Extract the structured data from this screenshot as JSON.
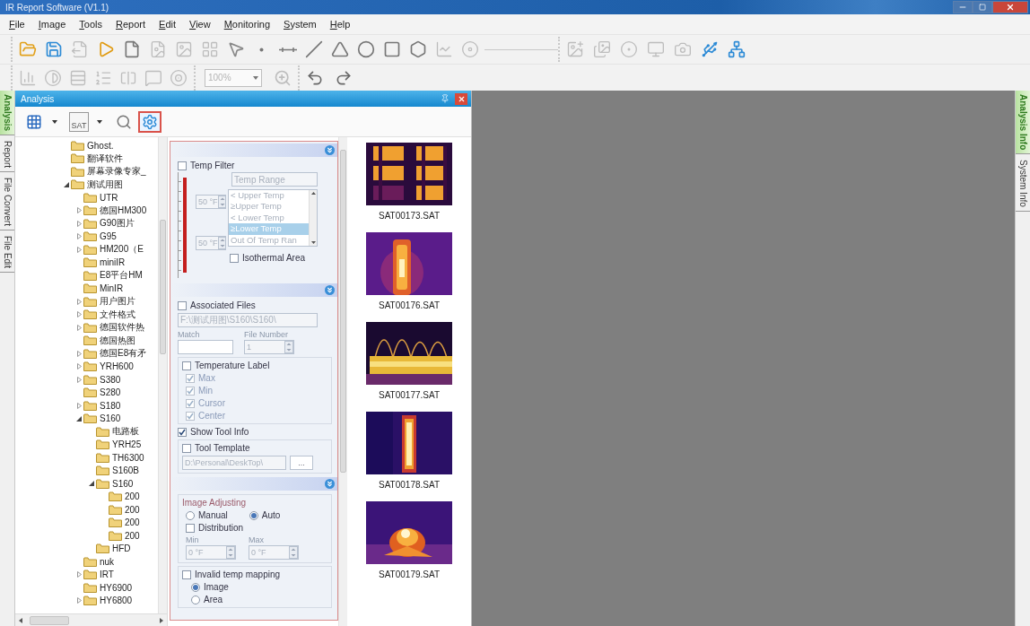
{
  "window": {
    "title": "IR Report Software (V1.1)"
  },
  "menu": [
    {
      "label": "File"
    },
    {
      "label": "Image"
    },
    {
      "label": "Tools"
    },
    {
      "label": "Report"
    },
    {
      "label": "Edit"
    },
    {
      "label": "View"
    },
    {
      "label": "Monitoring"
    },
    {
      "label": "System"
    },
    {
      "label": "Help"
    }
  ],
  "toolbars": {
    "main": [
      {
        "disabled": false
      },
      {
        "disabled": false
      },
      {
        "disabled": true
      },
      {
        "disabled": false
      },
      {
        "disabled": false
      },
      {
        "disabled": true
      },
      {
        "disabled": true
      },
      {
        "disabled": true
      },
      {
        "disabled": false
      },
      {
        "disabled": false
      },
      {
        "disabled": false
      },
      {
        "disabled": false
      },
      {
        "disabled": false
      },
      {
        "disabled": false
      },
      {
        "disabled": false
      },
      {
        "disabled": false
      },
      {
        "disabled": true
      },
      {
        "disabled": true
      }
    ],
    "devices": [
      {
        "disabled": true
      },
      {
        "disabled": true
      },
      {
        "disabled": true
      },
      {
        "disabled": true
      },
      {
        "disabled": true
      },
      {
        "disabled": false
      },
      {
        "disabled": false
      }
    ],
    "view": [
      {
        "disabled": true
      },
      {
        "disabled": true
      },
      {
        "disabled": true
      },
      {
        "disabled": true
      },
      {
        "disabled": true
      },
      {
        "disabled": true
      },
      {
        "disabled": true
      }
    ],
    "zoom": {
      "value": "100%",
      "disabled": true
    },
    "history": [
      {
        "disabled": false
      },
      {
        "disabled": false
      }
    ]
  },
  "left_tabs": [
    {
      "label": "Analysis",
      "selected": true
    },
    {
      "label": "Report",
      "selected": false
    },
    {
      "label": "File Convert",
      "selected": false
    },
    {
      "label": "File Edit",
      "selected": false
    }
  ],
  "right_tabs": [
    {
      "label": "Analysis Info",
      "selected": true
    },
    {
      "label": "System Info",
      "selected": false
    }
  ],
  "panel": {
    "title": "Analysis"
  },
  "analysis_tools": [
    {
      "selected": false,
      "menu": true
    },
    {
      "selected": false,
      "menu": true,
      "badge": "SAT"
    },
    {
      "selected": false
    },
    {
      "selected": true
    }
  ],
  "tree": {
    "items": [
      {
        "label": "Ghost."
      },
      {
        "label": "翻译软件"
      },
      {
        "label": "屏幕录像专家_"
      },
      {
        "label": "测试用图",
        "expanded": true,
        "children": [
          {
            "label": "UTR"
          },
          {
            "label": "德国HM300",
            "expanded": false
          },
          {
            "label": "G90图片",
            "expanded": false
          },
          {
            "label": "G95",
            "expanded": false
          },
          {
            "label": "HM200（E",
            "expanded": false
          },
          {
            "label": "miniIR"
          },
          {
            "label": "E8平台HM"
          },
          {
            "label": "MinIR"
          },
          {
            "label": "用户图片",
            "expanded": false
          },
          {
            "label": "文件格式",
            "expanded": false
          },
          {
            "label": "德国软件热",
            "expanded": false
          },
          {
            "label": "德国热图"
          },
          {
            "label": "德国E8有矛",
            "expanded": false
          },
          {
            "label": "YRH600",
            "expanded": false
          },
          {
            "label": "S380",
            "expanded": false
          },
          {
            "label": "S280"
          },
          {
            "label": "S180",
            "expanded": false
          },
          {
            "label": "S160",
            "expanded": true,
            "children": [
              {
                "label": "电路板"
              },
              {
                "label": "YRH25"
              },
              {
                "label": "TH6300"
              },
              {
                "label": "S160B"
              },
              {
                "label": "S160",
                "expanded": true,
                "children": [
                  {
                    "label": "200"
                  },
                  {
                    "label": "200"
                  },
                  {
                    "label": "200"
                  },
                  {
                    "label": "200"
                  }
                ]
              },
              {
                "label": "HFD"
              }
            ]
          },
          {
            "label": "nuk"
          },
          {
            "label": "IRT",
            "expanded": false
          },
          {
            "label": "HY6900"
          },
          {
            "label": "HY6800",
            "expanded": false
          }
        ]
      }
    ]
  },
  "settings": {
    "temp_filter": {
      "label": "Temp Filter",
      "checked": false
    },
    "temp_range": {
      "value": "Temp Range",
      "disabled": true
    },
    "upper_temp": {
      "value": "50 °F",
      "disabled": true
    },
    "lower_temp": {
      "value": "50 °F",
      "disabled": true
    },
    "range_options": [
      {
        "label": "< Upper Temp",
        "selected": false
      },
      {
        "label": "≥Upper Temp",
        "selected": false
      },
      {
        "label": "< Lower Temp",
        "selected": false
      },
      {
        "label": "≥Lower Temp",
        "selected": true
      },
      {
        "label": "Out Of Temp Ran",
        "selected": false
      }
    ],
    "isothermal": {
      "label": "Isothermal Area",
      "checked": false
    },
    "associated_files": {
      "label": "Associated Files",
      "checked": false
    },
    "path": {
      "value": "F:\\测试用图\\S160\\S160\\",
      "disabled": true
    },
    "match": {
      "label": "Match"
    },
    "file_number": {
      "label": "File Number",
      "value": "1",
      "disabled": true
    },
    "temperature_label": {
      "label": "Temperature Label",
      "checked": false,
      "options": [
        {
          "label": "Max",
          "checked": true,
          "disabled": true
        },
        {
          "label": "Min",
          "checked": true,
          "disabled": true
        },
        {
          "label": "Cursor",
          "checked": true,
          "disabled": true
        },
        {
          "label": "Center",
          "checked": true,
          "disabled": true
        }
      ]
    },
    "show_tool_info": {
      "label": "Show Tool Info",
      "checked": true
    },
    "tool_template": {
      "label": "Tool Template",
      "checked": false,
      "path": "D:\\Personal\\DeskTop\\",
      "browse": "..."
    },
    "image_adjusting": {
      "label": "Image Adjusting",
      "modes": [
        {
          "label": "Manual",
          "selected": false
        },
        {
          "label": "Auto",
          "selected": true
        }
      ],
      "distribution": {
        "label": "Distribution",
        "checked": false
      },
      "min": {
        "label": "Min",
        "value": "0 °F",
        "disabled": true
      },
      "max": {
        "label": "Max",
        "value": "0 °F",
        "disabled": true
      }
    },
    "invalid_mapping": {
      "label": "Invalid temp mapping",
      "checked": false,
      "targets": [
        {
          "label": "Image",
          "selected": true
        },
        {
          "label": "Area",
          "selected": false
        }
      ]
    }
  },
  "thumbnails": [
    {
      "name": "SAT00173.SAT"
    },
    {
      "name": "SAT00176.SAT"
    },
    {
      "name": "SAT00177.SAT"
    },
    {
      "name": "SAT00178.SAT"
    },
    {
      "name": "SAT00179.SAT"
    }
  ]
}
